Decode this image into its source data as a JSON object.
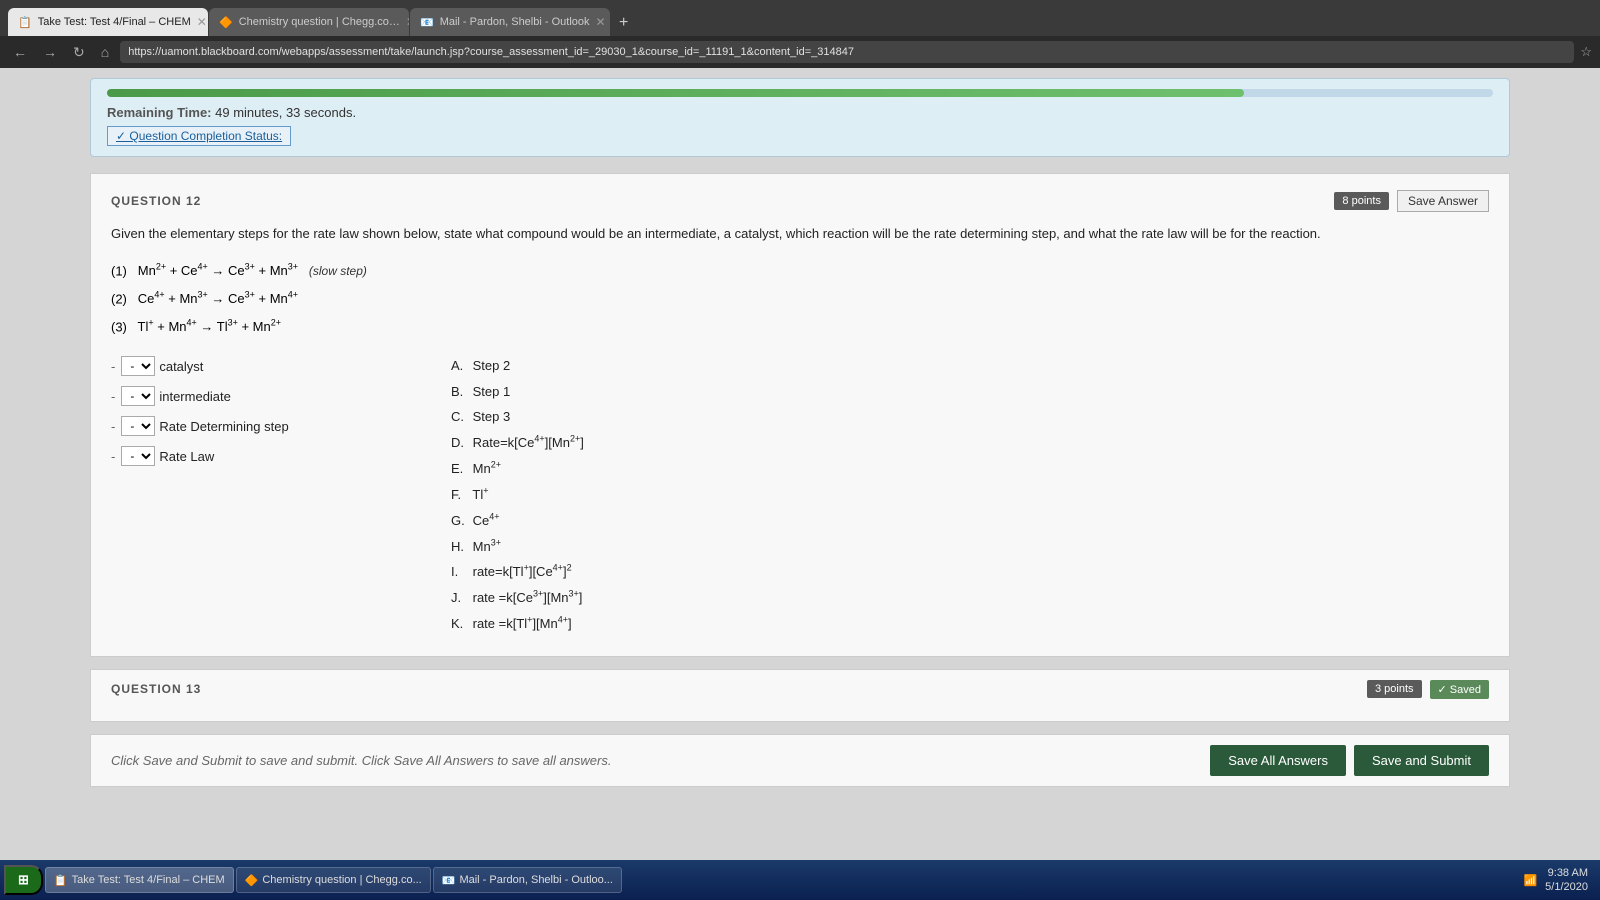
{
  "browser": {
    "tabs": [
      {
        "id": "tab1",
        "label": "Take Test: Test 4/Final – CHEM",
        "active": true,
        "icon": "📋"
      },
      {
        "id": "tab2",
        "label": "Chemistry question | Chegg.co…",
        "active": false,
        "icon": "🔶"
      },
      {
        "id": "tab3",
        "label": "Mail - Pardon, Shelbi - Outlook",
        "active": false,
        "icon": "📧"
      }
    ],
    "url": "https://uamont.blackboard.com/webapps/assessment/take/launch.jsp?course_assessment_id=_29030_1&course_id=_11191_1&content_id=_314847"
  },
  "timer": {
    "remaining_label": "Remaining Time:",
    "remaining_value": "49 minutes, 33 seconds.",
    "completion_link": "✓ Question Completion Status:"
  },
  "question12": {
    "number": "QUESTION 12",
    "points": "8 points",
    "save_button": "Save Answer",
    "text": "Given the elementary steps for the rate law shown below, state what compound would be an intermediate, a catalyst, which reaction will be the rate determining step, and what the rate law will be for the reaction.",
    "equations": [
      {
        "num": "(1)",
        "eq": "Mn²⁺ + Ce⁴⁺ → Ce³⁺ + Mn³⁺",
        "note": "(slow step)"
      },
      {
        "num": "(2)",
        "eq": "Ce⁴⁺ + Mn³⁺ → Ce³⁺ + Mn⁴⁺",
        "note": ""
      },
      {
        "num": "(3)",
        "eq": "Tl⁺ + Mn⁴⁺ → Tl³⁺ + Mn²⁺",
        "note": ""
      }
    ],
    "dropdowns": [
      {
        "label": "catalyst"
      },
      {
        "label": "intermediate"
      },
      {
        "label": "Rate Determining step"
      },
      {
        "label": "Rate Law"
      }
    ],
    "choices": [
      {
        "letter": "A.",
        "text": "Step 2"
      },
      {
        "letter": "B.",
        "text": "Step 1"
      },
      {
        "letter": "C.",
        "text": "Step 3"
      },
      {
        "letter": "D.",
        "text": "Rate=k[Ce⁴⁺][Mn²⁺]"
      },
      {
        "letter": "E.",
        "text": "Mn²⁺"
      },
      {
        "letter": "F.",
        "text": "Tl⁺"
      },
      {
        "letter": "G.",
        "text": "Ce⁴⁺"
      },
      {
        "letter": "H.",
        "text": "Mn³⁺"
      },
      {
        "letter": "I.",
        "text": "rate=k[Tl⁺][Ce⁴⁺]²"
      },
      {
        "letter": "J.",
        "text": "rate =k[Ce³⁺][Mn³⁺]"
      },
      {
        "letter": "K.",
        "text": "rate =k[Tl⁺][Mn⁴⁺]"
      }
    ]
  },
  "question13": {
    "number": "QUESTION 13",
    "points": "3 points",
    "saved_label": "✓ Saved"
  },
  "footer": {
    "instruction": "Click Save and Submit to save and submit. Click Save All Answers to save all answers.",
    "save_all_btn": "Save All Answers",
    "submit_btn": "Save and Submit"
  },
  "taskbar": {
    "start_label": "Start",
    "items": [
      {
        "label": "Take Test: Test 4/Final – CHEM",
        "active": true
      },
      {
        "label": "Chemistry question | Chegg.co...",
        "active": false
      },
      {
        "label": "Mail - Pardon, Shelbi - Outloo...",
        "active": false
      }
    ],
    "time": "9:38 AM",
    "date": "5/1/2020"
  }
}
